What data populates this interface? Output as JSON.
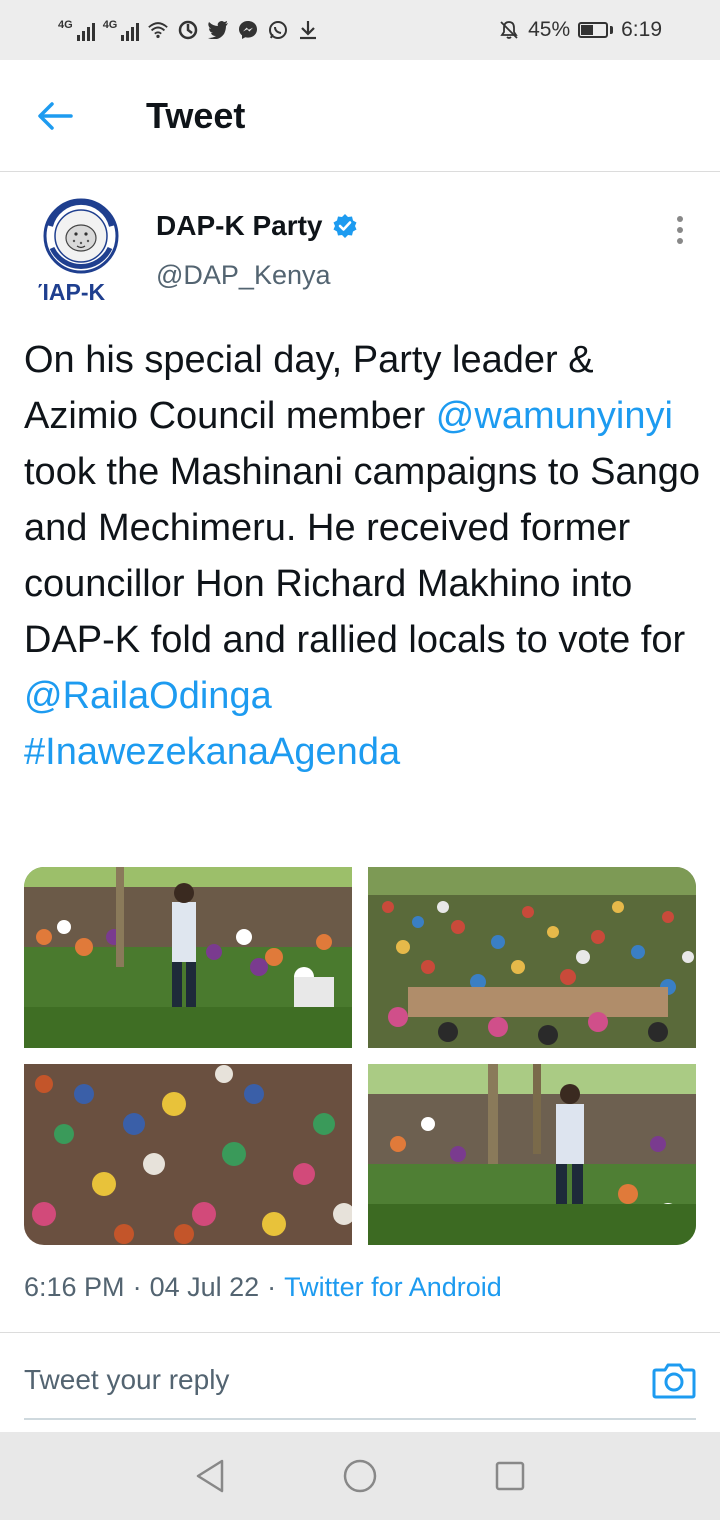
{
  "status_bar": {
    "network1": "4G",
    "network2": "4G",
    "battery_percent": "45%",
    "battery_level": 0.45,
    "time": "6:19",
    "icons": [
      "signal-icon",
      "signal-icon",
      "wifi-icon",
      "vpn-icon",
      "twitter-icon",
      "messenger-icon",
      "whatsapp-icon",
      "download-icon",
      "mute-icon",
      "battery-icon"
    ]
  },
  "header": {
    "title": "Tweet"
  },
  "tweet": {
    "author_name": "DAP-K Party",
    "author_handle": "@DAP_Kenya",
    "avatar_logo_text": "DAP-K",
    "text": {
      "t1": "On his special day, Party leader & Azimio Council member ",
      "mention1": "@wamunyinyi",
      "t2": " took the Mashinani campaigns to Sango and Mechimeru. He received former councillor Hon Richard Makhino into DAP-K fold and rallied locals to vote for ",
      "mention2": "@RailaOdinga",
      "hashtag": "#InawezekanaAgenda"
    },
    "timestamp": "6:16 PM",
    "dot1": "·",
    "date": "04 Jul 22",
    "dot2": "·",
    "source": "Twitter for Android"
  },
  "reply": {
    "placeholder": "Tweet your reply"
  },
  "colors": {
    "link": "#1d9bf0",
    "verified": "#1d9bf0",
    "secondary_text": "#536471"
  }
}
